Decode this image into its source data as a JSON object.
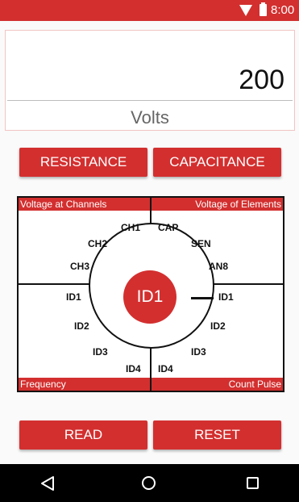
{
  "status_bar": {
    "time": "8:00"
  },
  "display": {
    "value": "200",
    "unit": "Volts"
  },
  "mode_buttons": {
    "resistance": "RESISTANCE",
    "capacitance": "CAPACITANCE"
  },
  "panel": {
    "headers": {
      "top_left": "Voltage at Channels",
      "top_right": "Voltage of Elements",
      "bottom_left": "Frequency",
      "bottom_right": "Count Pulse"
    },
    "center": "ID1",
    "left_labels": [
      "CH1",
      "CH2",
      "CH3",
      "ID1",
      "ID2",
      "ID3",
      "ID4"
    ],
    "right_labels": [
      "CAP",
      "SEN",
      "AN8",
      "ID1",
      "ID2",
      "ID3",
      "ID4"
    ]
  },
  "action_buttons": {
    "read": "READ",
    "reset": "RESET"
  },
  "icons": {
    "wifi": "wifi-icon",
    "battery": "battery-icon",
    "back": "back-icon",
    "home": "home-icon",
    "recents": "recents-icon"
  },
  "colors": {
    "accent": "#d32f2f",
    "status_bar": "#d32f2f",
    "nav_bar": "#000000"
  }
}
